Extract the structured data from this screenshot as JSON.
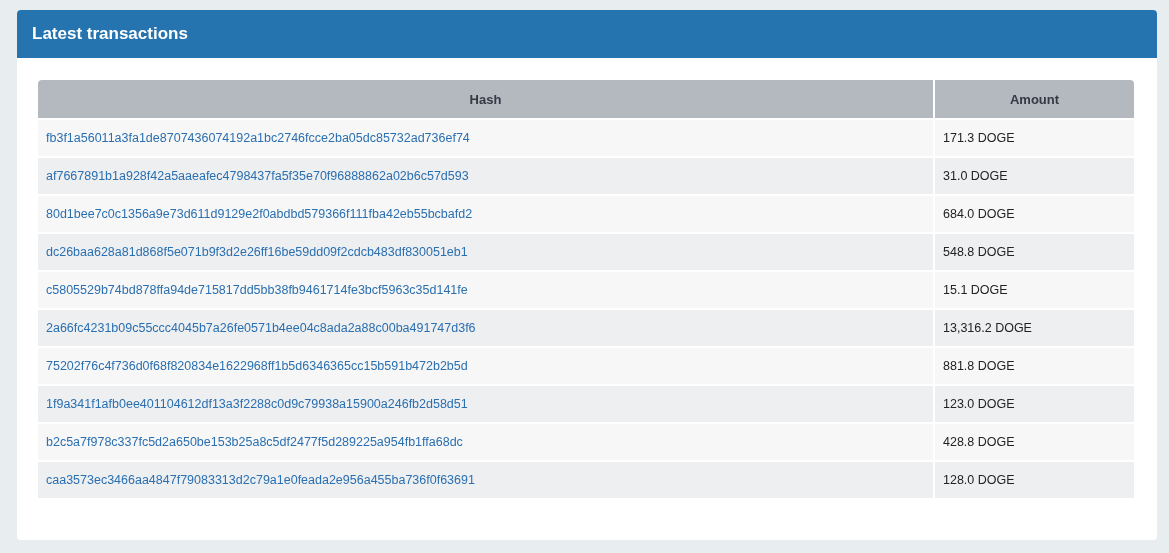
{
  "panel": {
    "title": "Latest transactions"
  },
  "table": {
    "columns": [
      "Hash",
      "Amount"
    ],
    "rows": [
      {
        "hash": "fb3f1a56011a3fa1de8707436074192a1bc2746fcce2ba05dc85732ad736ef74",
        "amount": "171.3 DOGE"
      },
      {
        "hash": "af7667891b1a928f42a5aaeafec4798437fa5f35e70f96888862a02b6c57d593",
        "amount": "31.0 DOGE"
      },
      {
        "hash": "80d1bee7c0c1356a9e73d611d9129e2f0abdbd579366f111fba42eb55bcbafd2",
        "amount": "684.0 DOGE"
      },
      {
        "hash": "dc26baa628a81d868f5e071b9f3d2e26ff16be59dd09f2cdcb483df830051eb1",
        "amount": "548.8 DOGE"
      },
      {
        "hash": "c5805529b74bd878ffa94de715817dd5bb38fb9461714fe3bcf5963c35d141fe",
        "amount": "15.1 DOGE"
      },
      {
        "hash": "2a66fc4231b09c55ccc4045b7a26fe0571b4ee04c8ada2a88c00ba491747d3f6",
        "amount": "13,316.2 DOGE"
      },
      {
        "hash": "75202f76c4f736d0f68f820834e1622968ff1b5d6346365cc15b591b472b2b5d",
        "amount": "881.8 DOGE"
      },
      {
        "hash": "1f9a341f1afb0ee401104612df13a3f2288c0d9c79938a15900a246fb2d58d51",
        "amount": "123.0 DOGE"
      },
      {
        "hash": "b2c5a7f978c337fc5d2a650be153b25a8c5df2477f5d289225a954fb1ffa68dc",
        "amount": "428.8 DOGE"
      },
      {
        "hash": "caa3573ec3466aa4847f79083313d2c79a1e0feada2e956a455ba736f0f63691",
        "amount": "128.0 DOGE"
      }
    ]
  }
}
